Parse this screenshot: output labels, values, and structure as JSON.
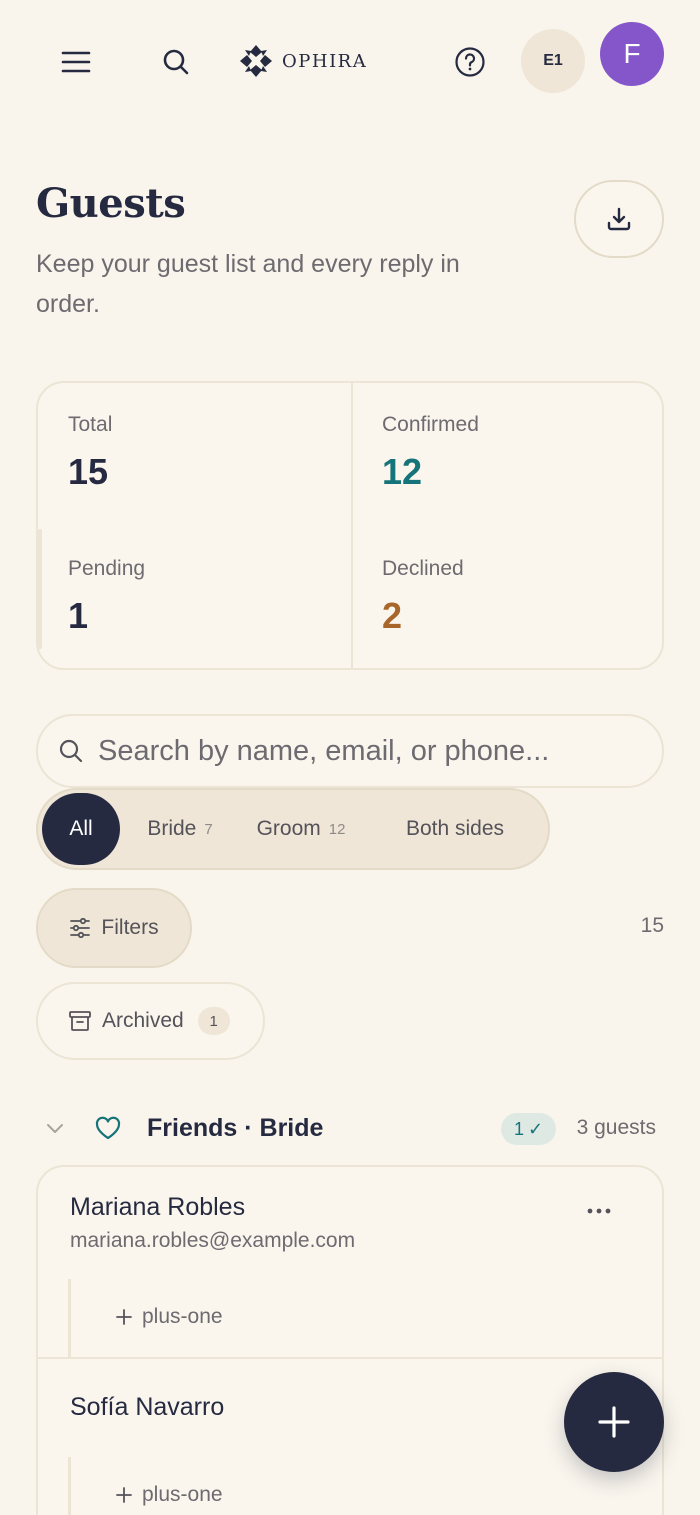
{
  "header": {
    "brand": "OPHIRA",
    "event_badge": "E1",
    "avatar_initial": "F"
  },
  "page": {
    "title": "Guests",
    "subtitle": "Keep your guest list and every reply in order."
  },
  "stats": {
    "total": {
      "label": "Total",
      "value": "15"
    },
    "confirmed": {
      "label": "Confirmed",
      "value": "12"
    },
    "pending": {
      "label": "Pending",
      "value": "1"
    },
    "declined": {
      "label": "Declined",
      "value": "2"
    }
  },
  "search": {
    "placeholder": "Search by name, email, or phone...",
    "value": ""
  },
  "segments": {
    "all": {
      "label": "All"
    },
    "bride": {
      "label": "Bride",
      "count": "7"
    },
    "groom": {
      "label": "Groom",
      "count": "12"
    },
    "both": {
      "label": "Both sides"
    }
  },
  "filters": {
    "label": "Filters",
    "result_count": "15"
  },
  "archived": {
    "label": "Archived",
    "count": "1"
  },
  "group": {
    "title": "Friends · Bride",
    "confirmed_count": "1",
    "confirmed_mark": "✓",
    "guest_count": "3 guests",
    "guests": [
      {
        "name": "Mariana Robles",
        "email": "mariana.robles@example.com",
        "plus_one_label": "plus-one"
      },
      {
        "name": "Sofía Navarro",
        "plus_one_label": "plus-one"
      }
    ]
  },
  "colors": {
    "background": "#f9f5ec",
    "ink": "#262a40",
    "confirmed": "#15737a",
    "declined": "#a8672a",
    "avatar": "#8556c9"
  },
  "icons": [
    "menu-icon",
    "search-icon",
    "ophira-logo",
    "help-icon",
    "download-icon",
    "sliders-icon",
    "archive-icon",
    "chevron-down-icon",
    "heart-icon",
    "more-icon",
    "plus-icon"
  ]
}
